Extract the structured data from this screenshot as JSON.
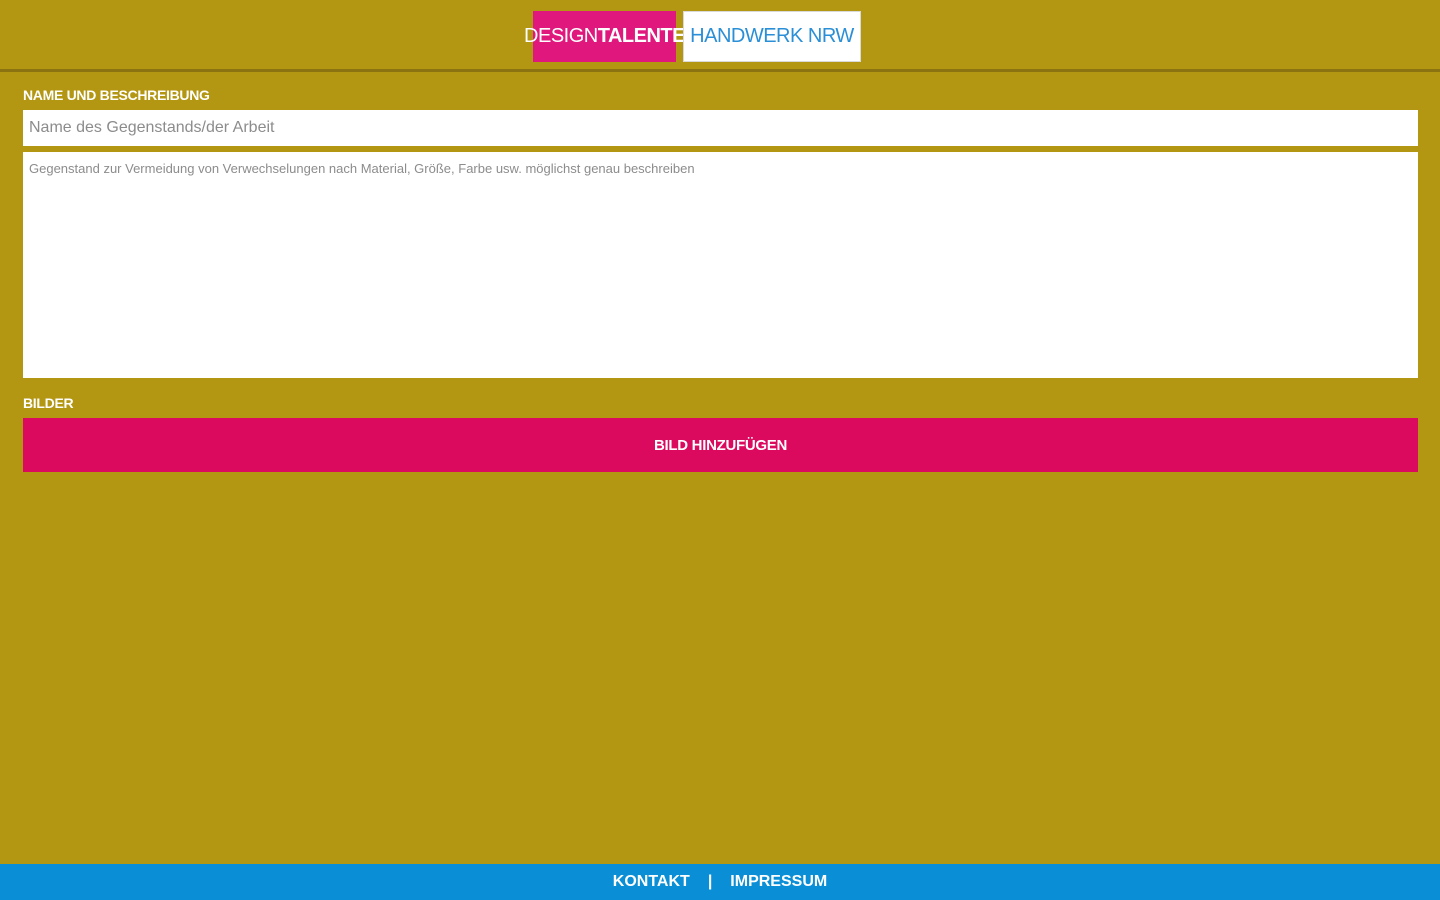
{
  "header": {
    "tabs": {
      "design": {
        "label_part1": "DESIGN",
        "label_part2": "TALENTE"
      },
      "handwerk": {
        "label": "HANDWERK NRW"
      }
    }
  },
  "form": {
    "name_section_label": "NAME UND BESCHREIBUNG",
    "name_input": {
      "value": "",
      "placeholder": "Name des Gegenstands/der Arbeit"
    },
    "description_input": {
      "value": "",
      "placeholder": "Gegenstand zur Vermeidung von Verwechselungen nach Material, Größe, Farbe usw. möglichst genau beschreiben"
    },
    "images_section_label": "BILDER",
    "add_image_button": "BILD HINZUFÜGEN"
  },
  "footer": {
    "contact": "KONTAKT",
    "separator": "|",
    "imprint": "IMPRESSUM"
  },
  "colors": {
    "background": "#b39612",
    "accent_pink": "#dc0a5f",
    "tab_pink": "#e0177d",
    "footer_blue": "#0a8fd7",
    "tab_blue_text": "#2a8fd6"
  }
}
